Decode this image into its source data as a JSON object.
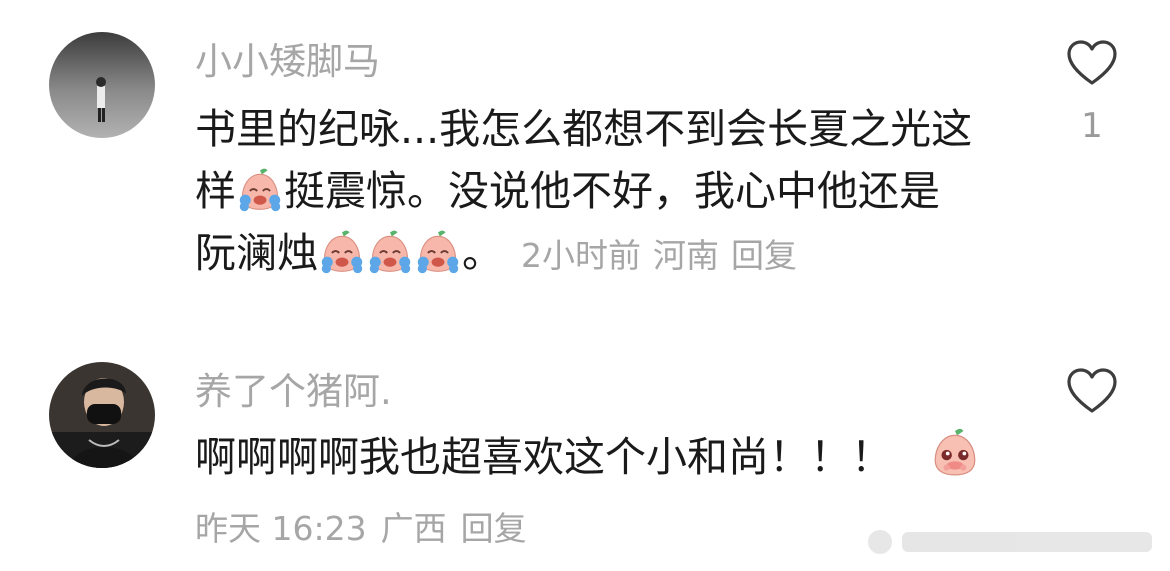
{
  "comments": [
    {
      "username": "小小矮脚马",
      "text_lines": [
        "书里的纪咏...我怎么都想不到会长夏之光这",
        "样",
        "挺震惊。没说他不好，我心中他还是",
        "阮澜烛",
        "。"
      ],
      "time": "2小时前",
      "location": "河南",
      "reply_label": "回复",
      "like_count": "1",
      "emojis": [
        "crying-laughing-peach-emoji"
      ]
    },
    {
      "username": "养了个猪阿.",
      "text": "啊啊啊啊我也超喜欢这个小和尚！！！",
      "time": "昨天 16:23",
      "location": "广西",
      "reply_label": "回复",
      "emojis": [
        "shy-peach-emoji"
      ]
    }
  ],
  "colors": {
    "meta": "#a6a6a6",
    "text": "#1a1a1a",
    "emoji_pink": "#f6b9ae"
  }
}
